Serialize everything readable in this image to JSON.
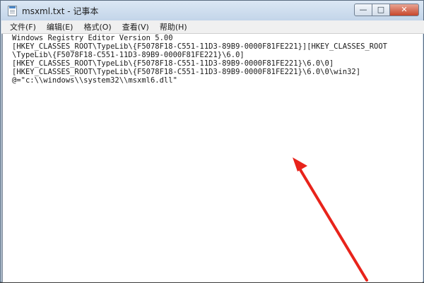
{
  "window": {
    "title": "msxml.txt - 记事本",
    "controls": {
      "minimize": "—",
      "maximize": "□",
      "close": "✕"
    }
  },
  "menu": {
    "items": [
      {
        "label": "文件(F)"
      },
      {
        "label": "编辑(E)"
      },
      {
        "label": "格式(O)"
      },
      {
        "label": "查看(V)"
      },
      {
        "label": "帮助(H)"
      }
    ]
  },
  "editor": {
    "lines": [
      "Windows Registry Editor Version 5.00",
      "[HKEY_CLASSES_ROOT\\TypeLib\\{F5078F18-C551-11D3-89B9-0000F81FE221}][HKEY_CLASSES_ROOT",
      "\\TypeLib\\{F5078F18-C551-11D3-89B9-0000F81FE221}\\6.0]",
      "[HKEY_CLASSES_ROOT\\TypeLib\\{F5078F18-C551-11D3-89B9-0000F81FE221}\\6.0\\0]",
      "[HKEY_CLASSES_ROOT\\TypeLib\\{F5078F18-C551-11D3-89B9-0000F81FE221}\\6.0\\0\\win32]",
      "@=\"c:\\\\windows\\\\system32\\\\msxml6.dll\""
    ]
  },
  "annotation": {
    "arrow_color": "#e8231b"
  }
}
